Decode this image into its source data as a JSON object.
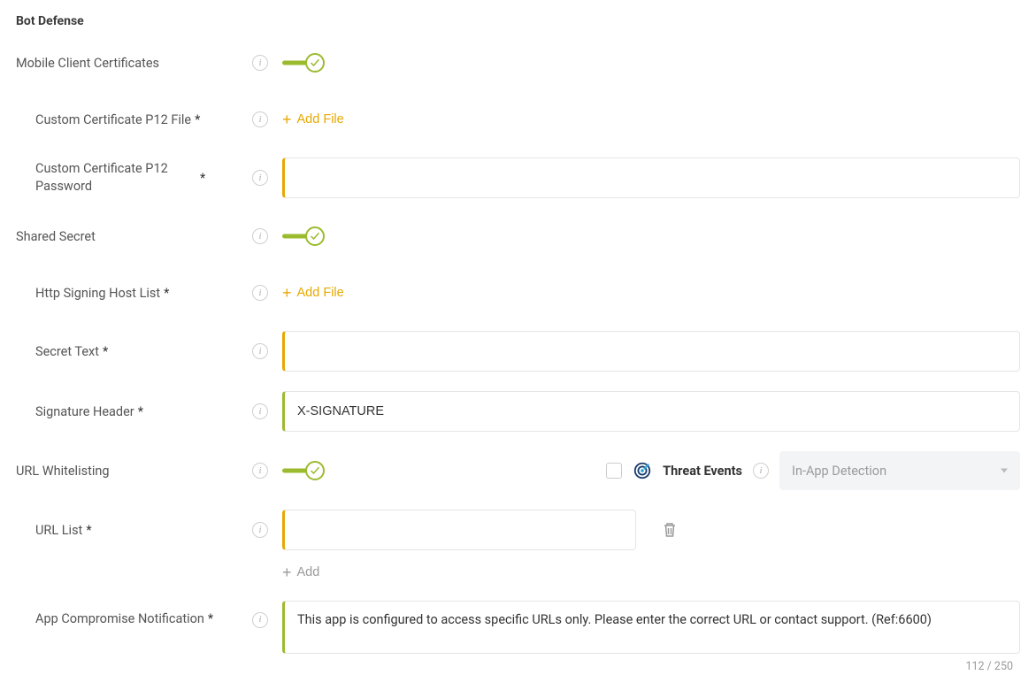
{
  "section_title": "Bot Defense",
  "labels": {
    "mobile_client_certs": "Mobile Client Certificates",
    "custom_cert_file": "Custom Certificate P12 File",
    "custom_cert_password": "Custom Certificate P12 Password",
    "shared_secret": "Shared Secret",
    "http_signing_host_list": "Http Signing Host List",
    "secret_text": "Secret Text",
    "signature_header": "Signature Header",
    "url_whitelisting": "URL Whitelisting",
    "url_list": "URL List",
    "app_compromise_notification": "App Compromise Notification",
    "threat_events": "Threat Events"
  },
  "buttons": {
    "add_file": "Add File",
    "add": "Add"
  },
  "values": {
    "custom_cert_password": "",
    "secret_text": "",
    "signature_header": "X-SIGNATURE",
    "url_list_item_0": "",
    "app_compromise_notification": "This app is configured to access specific URLs only. Please enter the correct URL or contact support. (Ref:6600)"
  },
  "select": {
    "in_app_detection": "In-App Detection"
  },
  "counter": {
    "app_compromise": "112 / 250"
  },
  "toggles": {
    "mobile_client_certs": true,
    "shared_secret": true,
    "url_whitelisting": true
  },
  "checkbox": {
    "threat_events": false
  }
}
